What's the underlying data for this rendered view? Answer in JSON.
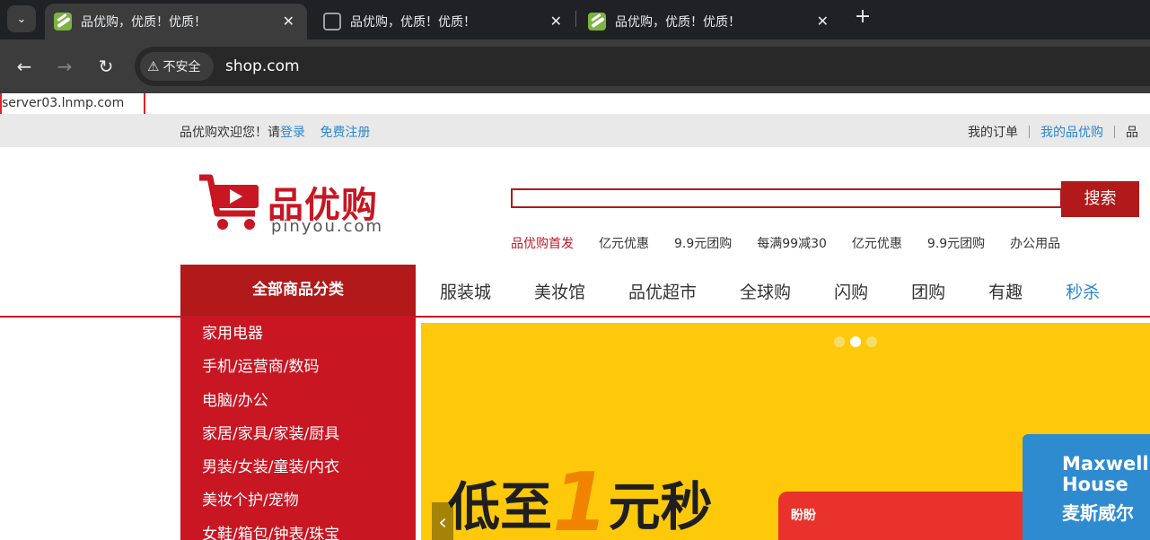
{
  "browser": {
    "tabs": [
      {
        "title": "品优购，优质！优质！",
        "active": true,
        "favicon": "leaf"
      },
      {
        "title": "品优购，优质！优质！",
        "active": false,
        "favicon": "globe"
      },
      {
        "title": "品优购，优质！优质！",
        "active": false,
        "favicon": "leaf"
      }
    ],
    "security_label": "不安全",
    "url": "shop.com"
  },
  "page": {
    "server_name": "server03.lnmp.com",
    "shortcut": {
      "welcome": "品优购欢迎您！请",
      "login": "登录",
      "register": "免费注册",
      "my_orders": "我的订单",
      "my_pinyou": "我的品优购",
      "more": "品"
    },
    "logo": {
      "name": "品优购",
      "domain": "pinyou.com"
    },
    "search": {
      "button": "搜索",
      "value": ""
    },
    "hotwords": [
      "品优购首发",
      "亿元优惠",
      "9.9元团购",
      "每满99减30",
      "亿元优惠",
      "9.9元团购",
      "办公用品"
    ],
    "all_categories": "全部商品分类",
    "main_nav": [
      "服装城",
      "美妆馆",
      "品优超市",
      "全球购",
      "闪购",
      "团购",
      "有趣",
      "秒杀"
    ],
    "categories": [
      "家用电器",
      "手机/运营商/数码",
      "电脑/办公",
      "家居/家具/家装/厨具",
      "男装/女装/童装/内衣",
      "美妆个护/宠物",
      "女鞋/箱包/钟表/珠宝"
    ],
    "banner": {
      "headline_a": "低至",
      "headline_b": "1",
      "headline_c": "元秒",
      "product_brand_line1": "Maxwell",
      "product_brand_line2": "House",
      "product_brand_cn": "麦斯威尔",
      "product2_label": "盼盼",
      "active_dot": 1
    },
    "colors": {
      "brand_red": "#c81623",
      "dark_red": "#b1191a",
      "link_blue": "#2b86d1",
      "banner_yellow": "#fdc90a"
    }
  }
}
